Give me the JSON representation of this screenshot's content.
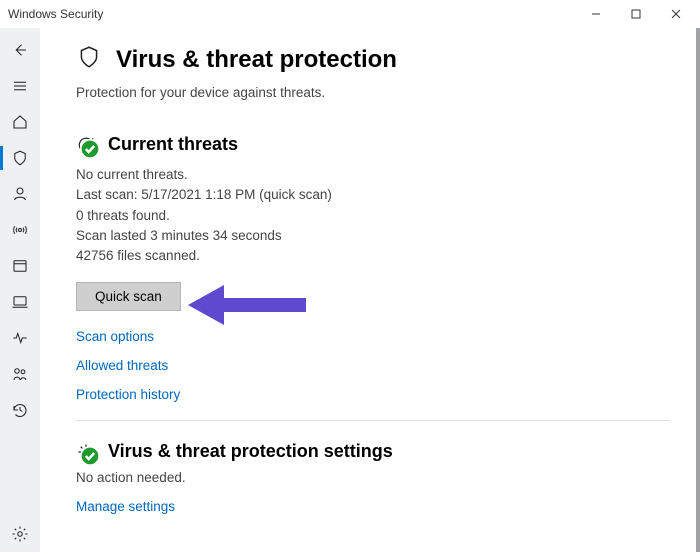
{
  "window": {
    "title": "Windows Security"
  },
  "page": {
    "title": "Virus & threat protection",
    "subtitle": "Protection for your device against threats."
  },
  "current_threats": {
    "section_title": "Current threats",
    "no_threats": "No current threats.",
    "last_scan": "Last scan: 5/17/2021 1:18 PM (quick scan)",
    "threats_found": "0 threats found.",
    "duration": "Scan lasted 3 minutes 34 seconds",
    "files_scanned": "42756 files scanned.",
    "quick_scan_button": "Quick scan",
    "links": {
      "scan_options": "Scan options",
      "allowed_threats": "Allowed threats",
      "protection_history": "Protection history"
    }
  },
  "settings_section": {
    "title": "Virus & threat protection settings",
    "status": "No action needed.",
    "manage_link": "Manage settings"
  }
}
